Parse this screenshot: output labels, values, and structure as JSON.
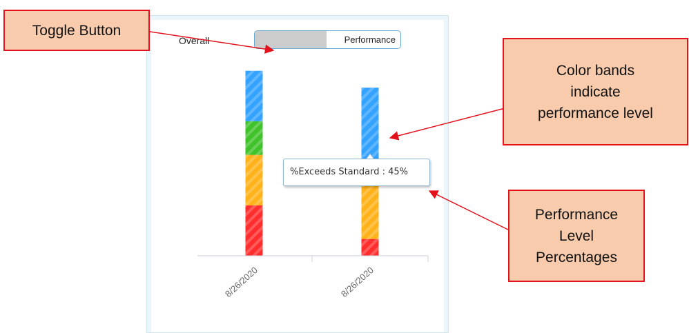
{
  "chart_data": {
    "type": "bar",
    "stacked": true,
    "orientation": "vertical",
    "categories": [
      "8/26/2020",
      "8/26/2020"
    ],
    "series": [
      {
        "color": "#ff2d2d",
        "values": [
          27,
          9
        ]
      },
      {
        "color": "#ffb21a",
        "values": [
          27,
          33
        ]
      },
      {
        "color": "#3fc22a",
        "values": [
          18,
          3
        ]
      },
      {
        "color": "#33a3ff",
        "values": [
          27,
          45
        ]
      }
    ],
    "tooltip": {
      "category_index": 1,
      "series_index": 3,
      "text": "%Exceeds Standard : 45%"
    },
    "ylim": [
      0,
      100
    ],
    "grid": false,
    "legend": "none",
    "xlabel": "",
    "ylabel": ""
  },
  "toggle": {
    "left_label": "Overall",
    "right_label": "Performance"
  },
  "callouts": {
    "toggle_button": "Toggle Button",
    "color_bands": [
      "Color bands",
      "indicate",
      "performance level"
    ],
    "percentages": [
      "Performance",
      "Level",
      "Percentages"
    ]
  },
  "colors": {
    "callout_fill": "#f8cbad",
    "callout_border": "#e3111c",
    "arrow": "#e3111c",
    "panel_border": "#cfe6ef",
    "toggle_border": "#6aa7cf"
  }
}
